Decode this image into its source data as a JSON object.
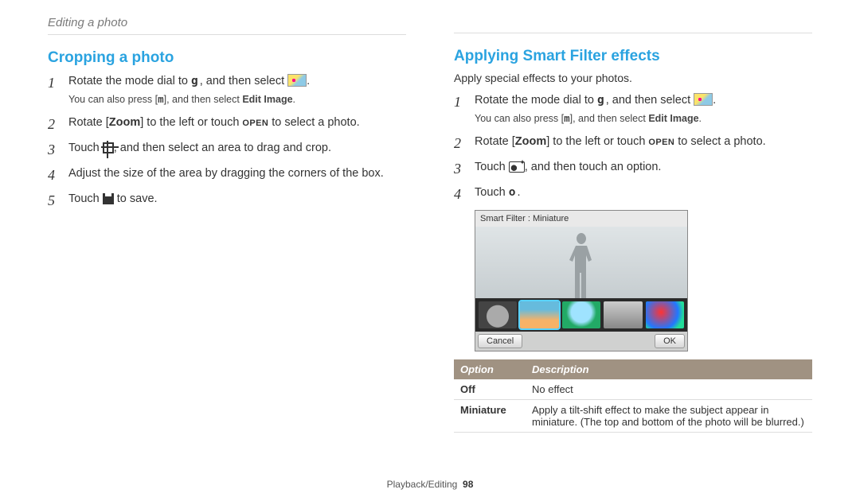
{
  "breadcrumb": "Editing a photo",
  "footer": {
    "section": "Playback/Editing",
    "page": "98"
  },
  "left": {
    "heading": "Cropping a photo",
    "steps": [
      {
        "pre": "Rotate the mode dial to ",
        "mode": "g",
        "mid": ", and then select ",
        "icon": "paint",
        "post": "."
      },
      {
        "parts": [
          "Rotate [",
          "Zoom",
          "] to the left or touch ",
          "OPEN",
          " to select a photo."
        ]
      },
      {
        "pre": "Touch ",
        "icon": "crop",
        "post": ", and then select an area to drag and crop."
      },
      {
        "text": "Adjust the size of the area by dragging the corners of the box."
      },
      {
        "pre": "Touch ",
        "icon": "disk",
        "post": " to save."
      }
    ],
    "note": {
      "pre": "You can also press [",
      "m": "m",
      "mid": "], and then select ",
      "strong": "Edit Image",
      "post": "."
    }
  },
  "right": {
    "heading": "Applying Smart Filter effects",
    "intro": "Apply special effects to your photos.",
    "steps": [
      {
        "pre": "Rotate the mode dial to ",
        "mode": "g",
        "mid": ", and then select ",
        "icon": "paint",
        "post": "."
      },
      {
        "parts": [
          "Rotate [",
          "Zoom",
          "] to the left or touch ",
          "OPEN",
          " to select a photo."
        ]
      },
      {
        "pre": "Touch ",
        "icon": "fx",
        "post": ", and then touch an option."
      },
      {
        "pre": "Touch ",
        "mode": "o",
        "post": "."
      }
    ],
    "note": {
      "pre": "You can also press [",
      "m": "m",
      "mid": "], and then select ",
      "strong": "Edit Image",
      "post": "."
    },
    "screenshot": {
      "label": "Smart Filter : Miniature",
      "cancel": "Cancel",
      "ok": "OK"
    },
    "table": {
      "headers": [
        "Option",
        "Description"
      ],
      "rows": [
        {
          "option": "Off",
          "desc": "No effect"
        },
        {
          "option": "Miniature",
          "desc": "Apply a tilt-shift effect to make the subject appear in miniature. (The top and bottom of the photo will be blurred.)"
        }
      ]
    }
  }
}
